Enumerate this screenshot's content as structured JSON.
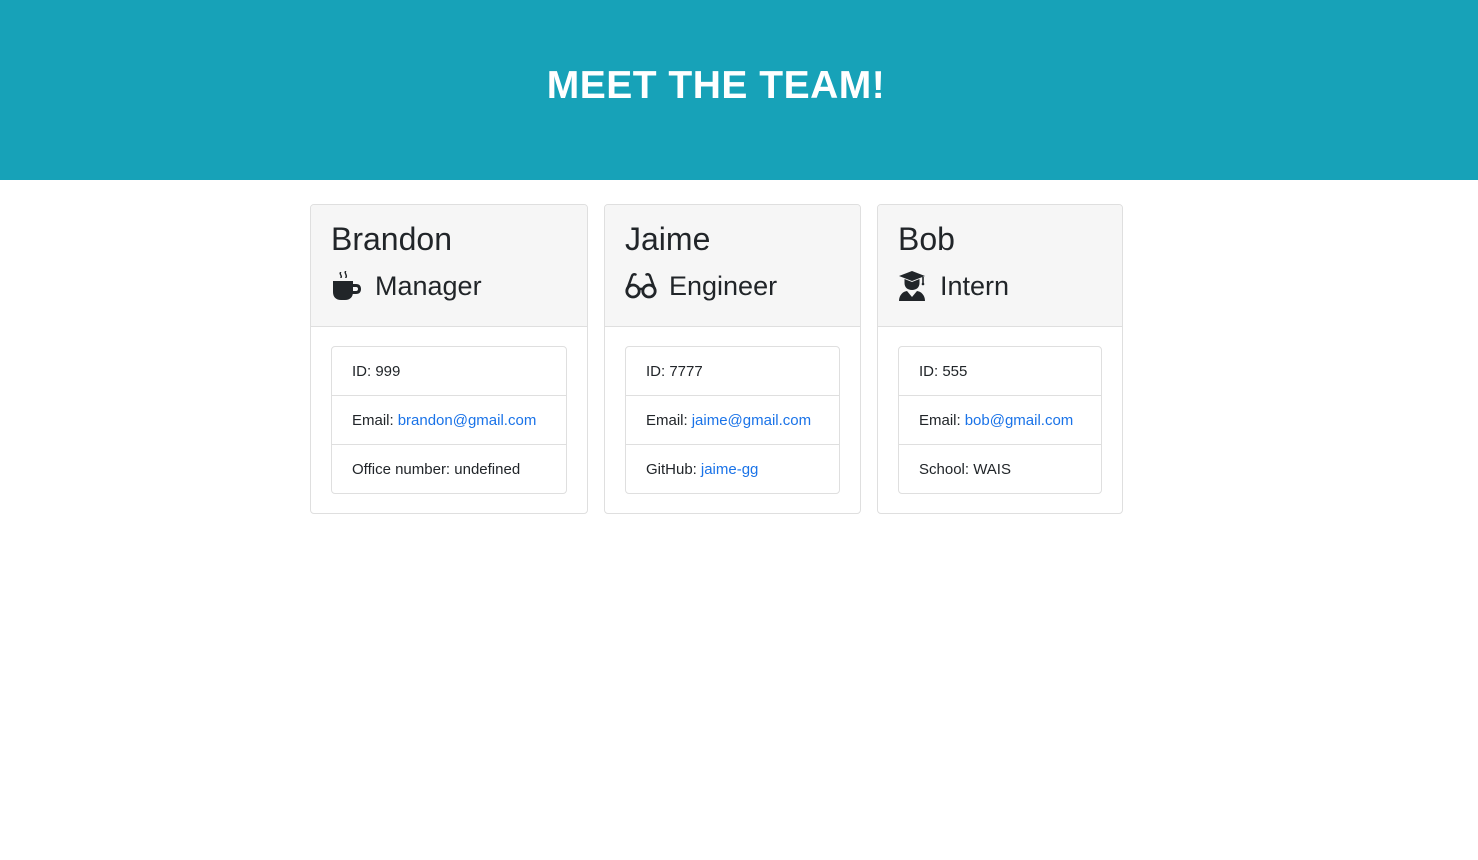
{
  "header": {
    "title": "MEET THE TEAM!"
  },
  "colors": {
    "header_bg": "#17a2b8",
    "link": "#1a73e8"
  },
  "cards": [
    {
      "name": "Brandon",
      "role": "Manager",
      "role_icon": "coffee-mug-icon",
      "id_label": "ID: 999",
      "email_label": "Email:",
      "email": "brandon@gmail.com",
      "extra_text": "Office number: undefined"
    },
    {
      "name": "Jaime",
      "role": "Engineer",
      "role_icon": "glasses-icon",
      "id_label": "ID: 7777",
      "email_label": "Email:",
      "email": "jaime@gmail.com",
      "extra_label": "GitHub:",
      "extra_link": "jaime-gg"
    },
    {
      "name": "Bob",
      "role": "Intern",
      "role_icon": "graduate-icon",
      "id_label": "ID: 555",
      "email_label": "Email:",
      "email": "bob@gmail.com",
      "extra_text": "School: WAIS"
    }
  ]
}
